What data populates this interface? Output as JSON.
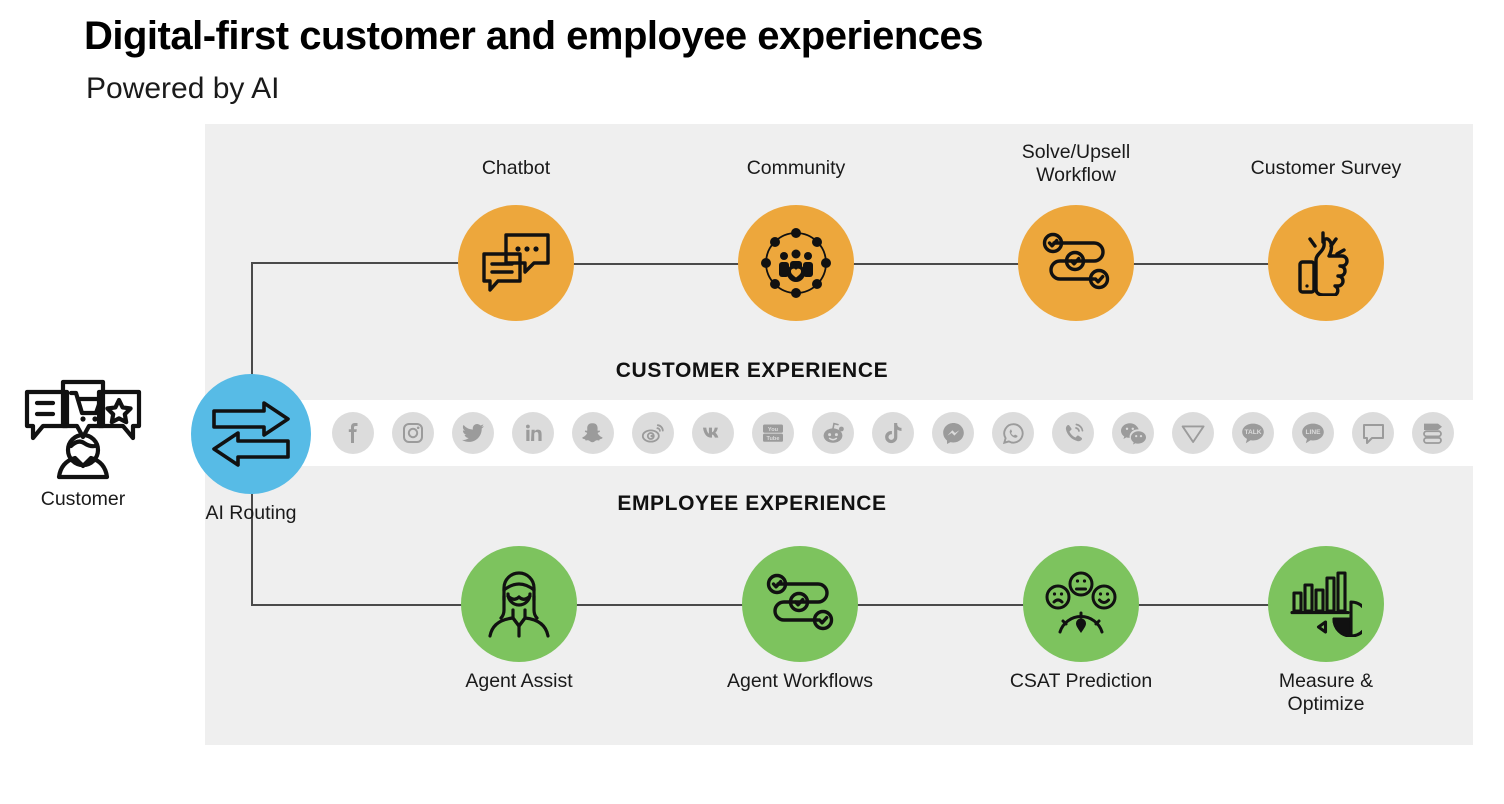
{
  "header": {
    "title": "Digital-first customer and employee experiences",
    "subtitle": "Powered by AI"
  },
  "sections": {
    "customer_experience_label": "CUSTOMER EXPERIENCE",
    "employee_experience_label": "EMPLOYEE EXPERIENCE"
  },
  "entry": {
    "customer_label": "Customer",
    "customer_icon": "customer-speech-bubbles-icon",
    "routing_label": "AI Routing",
    "routing_icon": "two-way-arrows-icon"
  },
  "colors": {
    "orange": "#eda73c",
    "green": "#7dc35e",
    "blue": "#57bbe6",
    "panel_bg": "#efefef",
    "strip_bg": "#ffffff",
    "line": "#4a4a4a",
    "social_chip": "#dcdcdc",
    "social_glyph": "#9b9b9b"
  },
  "customer_flow": [
    {
      "label": "Chatbot",
      "icon": "chat-bubbles-icon",
      "color": "#eda73c"
    },
    {
      "label": "Community",
      "icon": "community-network-icon",
      "color": "#eda73c"
    },
    {
      "label": "Solve/Upsell\nWorkflow",
      "icon": "workflow-check-nodes-icon",
      "color": "#eda73c"
    },
    {
      "label": "Customer Survey",
      "icon": "thumbs-up-icon",
      "color": "#eda73c"
    }
  ],
  "employee_flow": [
    {
      "label": "Agent Assist",
      "icon": "agent-person-icon",
      "color": "#7dc35e"
    },
    {
      "label": "Agent Workflows",
      "icon": "workflow-check-nodes-icon",
      "color": "#7dc35e"
    },
    {
      "label": "CSAT Prediction",
      "icon": "sentiment-gauge-faces-icon",
      "color": "#7dc35e"
    },
    {
      "label": "Measure &\nOptimize",
      "icon": "bar-pie-chart-icon",
      "color": "#7dc35e"
    }
  ],
  "social_channels": [
    {
      "name": "facebook",
      "icon": "facebook-icon"
    },
    {
      "name": "instagram",
      "icon": "instagram-icon"
    },
    {
      "name": "twitter",
      "icon": "twitter-icon"
    },
    {
      "name": "linkedin",
      "icon": "linkedin-icon"
    },
    {
      "name": "snapchat",
      "icon": "snapchat-icon"
    },
    {
      "name": "weibo",
      "icon": "weibo-icon"
    },
    {
      "name": "vk",
      "icon": "vk-icon"
    },
    {
      "name": "youtube",
      "icon": "youtube-icon"
    },
    {
      "name": "reddit",
      "icon": "reddit-icon"
    },
    {
      "name": "tiktok",
      "icon": "tiktok-icon"
    },
    {
      "name": "messenger",
      "icon": "messenger-icon"
    },
    {
      "name": "whatsapp",
      "icon": "whatsapp-icon"
    },
    {
      "name": "voice",
      "icon": "phone-ringing-icon"
    },
    {
      "name": "wechat",
      "icon": "wechat-icon"
    },
    {
      "name": "telegram",
      "icon": "telegram-icon"
    },
    {
      "name": "kakaotalk",
      "icon": "kakaotalk-icon",
      "text": "TALK"
    },
    {
      "name": "line",
      "icon": "line-icon",
      "text": "LINE"
    },
    {
      "name": "sms",
      "icon": "sms-chat-icon"
    },
    {
      "name": "messaging-list",
      "icon": "messaging-list-icon"
    }
  ]
}
